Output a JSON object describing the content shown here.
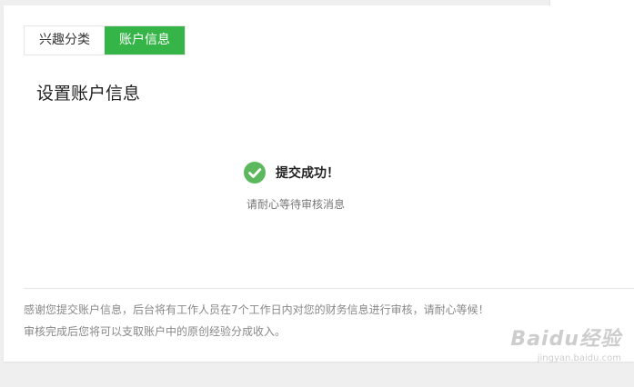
{
  "tabs": [
    {
      "label": "兴趣分类",
      "active": false
    },
    {
      "label": "账户信息",
      "active": true
    }
  ],
  "section_title": "设置账户信息",
  "success": {
    "title": "提交成功！",
    "subtitle": "请耐心等待审核消息",
    "icon": "check-circle-icon"
  },
  "notes": {
    "line1": "感谢您提交账户信息，后台将有工作人员在7个工作日内对您的财务信息进行审核，请耐心等候！",
    "line2": "审核完成后您将可以支取账户中的原创经验分成收入。"
  },
  "watermark": {
    "brand": "Baidu经验",
    "url": "jingyan.baidu.com"
  },
  "colors": {
    "accent": "#35b547",
    "check": "#5cb85c"
  }
}
